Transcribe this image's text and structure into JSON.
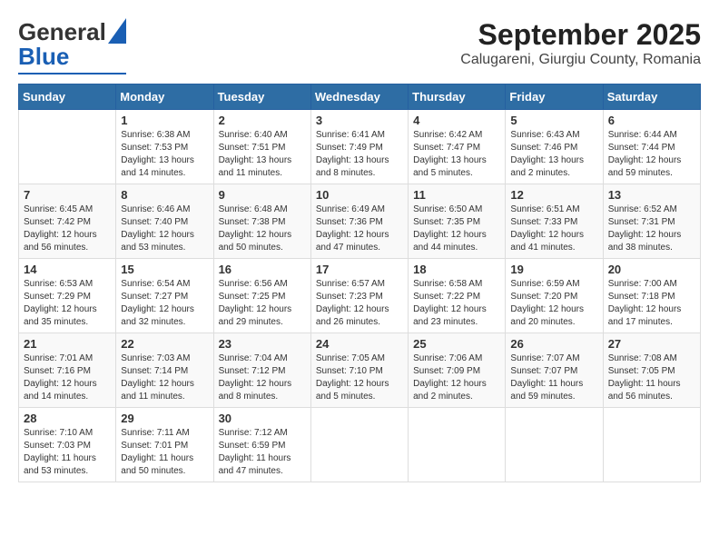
{
  "header": {
    "logo_general": "General",
    "logo_blue": "Blue",
    "title": "September 2025",
    "subtitle": "Calugareni, Giurgiu County, Romania"
  },
  "columns": [
    "Sunday",
    "Monday",
    "Tuesday",
    "Wednesday",
    "Thursday",
    "Friday",
    "Saturday"
  ],
  "weeks": [
    [
      {
        "day": "",
        "detail": ""
      },
      {
        "day": "1",
        "detail": "Sunrise: 6:38 AM\nSunset: 7:53 PM\nDaylight: 13 hours\nand 14 minutes."
      },
      {
        "day": "2",
        "detail": "Sunrise: 6:40 AM\nSunset: 7:51 PM\nDaylight: 13 hours\nand 11 minutes."
      },
      {
        "day": "3",
        "detail": "Sunrise: 6:41 AM\nSunset: 7:49 PM\nDaylight: 13 hours\nand 8 minutes."
      },
      {
        "day": "4",
        "detail": "Sunrise: 6:42 AM\nSunset: 7:47 PM\nDaylight: 13 hours\nand 5 minutes."
      },
      {
        "day": "5",
        "detail": "Sunrise: 6:43 AM\nSunset: 7:46 PM\nDaylight: 13 hours\nand 2 minutes."
      },
      {
        "day": "6",
        "detail": "Sunrise: 6:44 AM\nSunset: 7:44 PM\nDaylight: 12 hours\nand 59 minutes."
      }
    ],
    [
      {
        "day": "7",
        "detail": "Sunrise: 6:45 AM\nSunset: 7:42 PM\nDaylight: 12 hours\nand 56 minutes."
      },
      {
        "day": "8",
        "detail": "Sunrise: 6:46 AM\nSunset: 7:40 PM\nDaylight: 12 hours\nand 53 minutes."
      },
      {
        "day": "9",
        "detail": "Sunrise: 6:48 AM\nSunset: 7:38 PM\nDaylight: 12 hours\nand 50 minutes."
      },
      {
        "day": "10",
        "detail": "Sunrise: 6:49 AM\nSunset: 7:36 PM\nDaylight: 12 hours\nand 47 minutes."
      },
      {
        "day": "11",
        "detail": "Sunrise: 6:50 AM\nSunset: 7:35 PM\nDaylight: 12 hours\nand 44 minutes."
      },
      {
        "day": "12",
        "detail": "Sunrise: 6:51 AM\nSunset: 7:33 PM\nDaylight: 12 hours\nand 41 minutes."
      },
      {
        "day": "13",
        "detail": "Sunrise: 6:52 AM\nSunset: 7:31 PM\nDaylight: 12 hours\nand 38 minutes."
      }
    ],
    [
      {
        "day": "14",
        "detail": "Sunrise: 6:53 AM\nSunset: 7:29 PM\nDaylight: 12 hours\nand 35 minutes."
      },
      {
        "day": "15",
        "detail": "Sunrise: 6:54 AM\nSunset: 7:27 PM\nDaylight: 12 hours\nand 32 minutes."
      },
      {
        "day": "16",
        "detail": "Sunrise: 6:56 AM\nSunset: 7:25 PM\nDaylight: 12 hours\nand 29 minutes."
      },
      {
        "day": "17",
        "detail": "Sunrise: 6:57 AM\nSunset: 7:23 PM\nDaylight: 12 hours\nand 26 minutes."
      },
      {
        "day": "18",
        "detail": "Sunrise: 6:58 AM\nSunset: 7:22 PM\nDaylight: 12 hours\nand 23 minutes."
      },
      {
        "day": "19",
        "detail": "Sunrise: 6:59 AM\nSunset: 7:20 PM\nDaylight: 12 hours\nand 20 minutes."
      },
      {
        "day": "20",
        "detail": "Sunrise: 7:00 AM\nSunset: 7:18 PM\nDaylight: 12 hours\nand 17 minutes."
      }
    ],
    [
      {
        "day": "21",
        "detail": "Sunrise: 7:01 AM\nSunset: 7:16 PM\nDaylight: 12 hours\nand 14 minutes."
      },
      {
        "day": "22",
        "detail": "Sunrise: 7:03 AM\nSunset: 7:14 PM\nDaylight: 12 hours\nand 11 minutes."
      },
      {
        "day": "23",
        "detail": "Sunrise: 7:04 AM\nSunset: 7:12 PM\nDaylight: 12 hours\nand 8 minutes."
      },
      {
        "day": "24",
        "detail": "Sunrise: 7:05 AM\nSunset: 7:10 PM\nDaylight: 12 hours\nand 5 minutes."
      },
      {
        "day": "25",
        "detail": "Sunrise: 7:06 AM\nSunset: 7:09 PM\nDaylight: 12 hours\nand 2 minutes."
      },
      {
        "day": "26",
        "detail": "Sunrise: 7:07 AM\nSunset: 7:07 PM\nDaylight: 11 hours\nand 59 minutes."
      },
      {
        "day": "27",
        "detail": "Sunrise: 7:08 AM\nSunset: 7:05 PM\nDaylight: 11 hours\nand 56 minutes."
      }
    ],
    [
      {
        "day": "28",
        "detail": "Sunrise: 7:10 AM\nSunset: 7:03 PM\nDaylight: 11 hours\nand 53 minutes."
      },
      {
        "day": "29",
        "detail": "Sunrise: 7:11 AM\nSunset: 7:01 PM\nDaylight: 11 hours\nand 50 minutes."
      },
      {
        "day": "30",
        "detail": "Sunrise: 7:12 AM\nSunset: 6:59 PM\nDaylight: 11 hours\nand 47 minutes."
      },
      {
        "day": "",
        "detail": ""
      },
      {
        "day": "",
        "detail": ""
      },
      {
        "day": "",
        "detail": ""
      },
      {
        "day": "",
        "detail": ""
      }
    ]
  ]
}
